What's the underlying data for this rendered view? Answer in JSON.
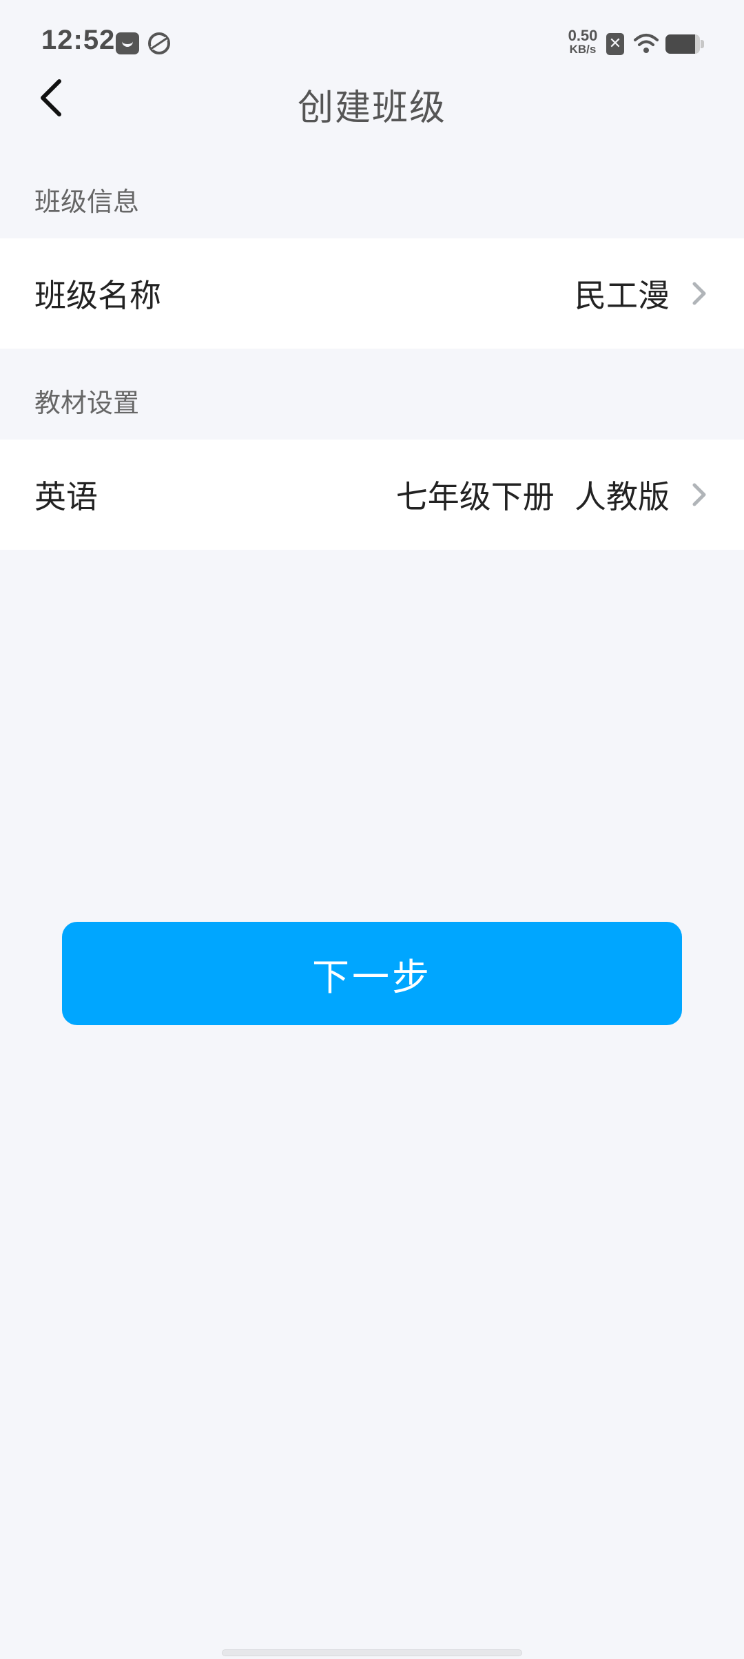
{
  "status_bar": {
    "time": "12:52",
    "net_speed_value": "0.50",
    "net_speed_unit": "KB/s",
    "sim_icon_glyph": "✕",
    "battery_level": 0.85,
    "icons": [
      "message-icon",
      "app-icon",
      "sim-icon",
      "wifi-icon",
      "battery-icon"
    ]
  },
  "nav": {
    "back_icon": "chevron-left-icon",
    "title": "创建班级"
  },
  "sections": [
    {
      "label": "班级信息",
      "row": {
        "label": "班级名称",
        "value": "民工漫",
        "icon": "chevron-right-icon"
      }
    },
    {
      "label": "教材设置",
      "row": {
        "label": "英语",
        "value": "七年级下册  人教版",
        "icon": "chevron-right-icon"
      }
    }
  ],
  "actions": {
    "next_label": "下一步"
  },
  "colors": {
    "background": "#f5f6fa",
    "primary": "#00a6ff",
    "row_background": "#ffffff",
    "chevron": "#b0b4b8"
  }
}
